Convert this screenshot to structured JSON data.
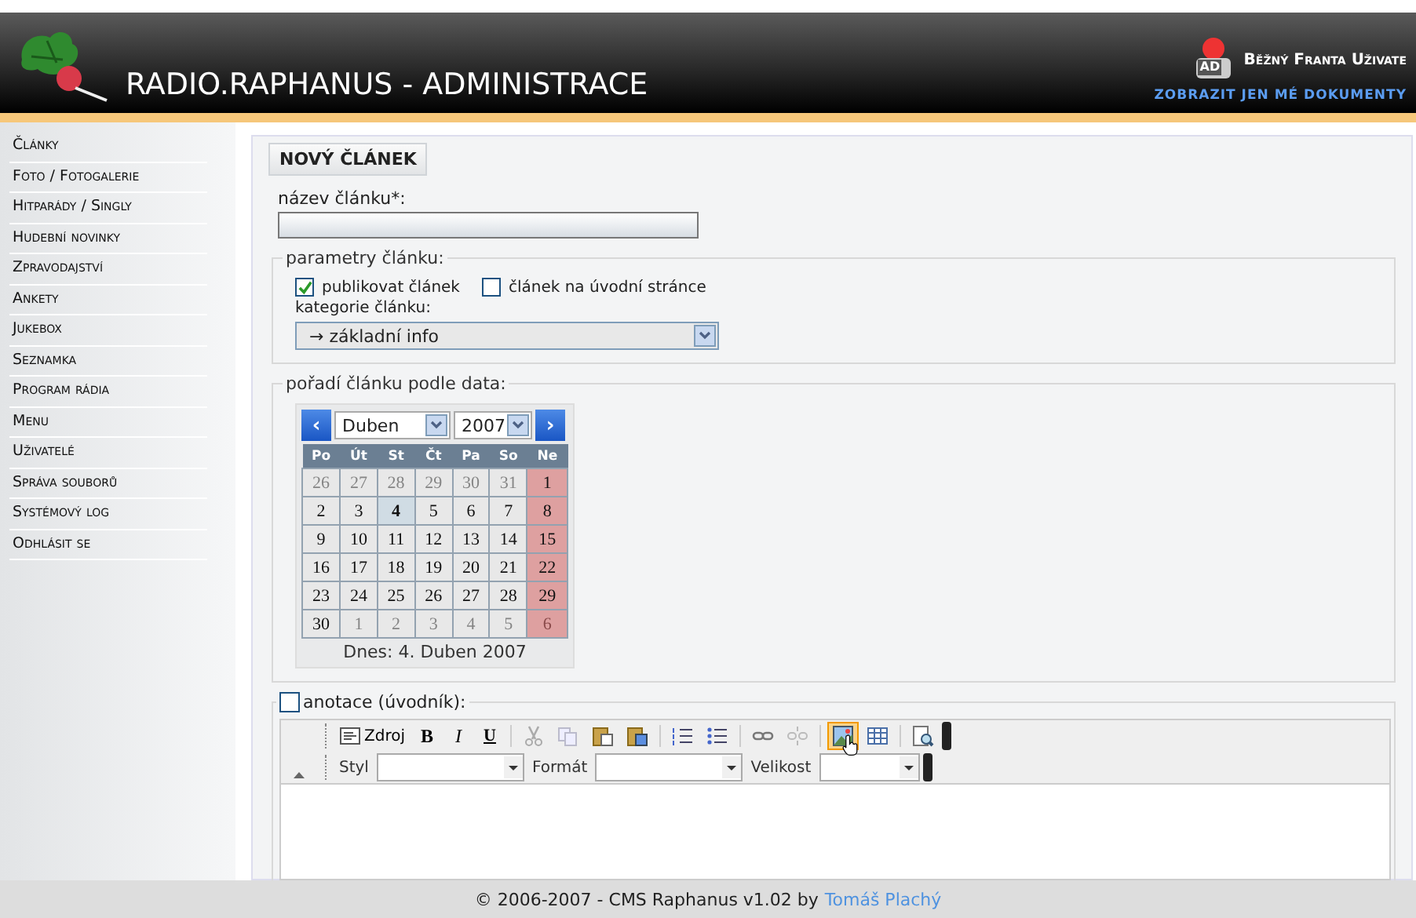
{
  "header": {
    "title": "RADIO.RAPHANUS - ADMINISTRACE",
    "user": "Běžný Franta Uživate",
    "user_badge": "AD",
    "my_docs_link": "ZOBRAZIT JEN MÉ DOKUMENTY"
  },
  "sidebar": {
    "items": [
      {
        "label": "Články"
      },
      {
        "label": "Foto / Fotogalerie"
      },
      {
        "label": "Hitparády / Singly"
      },
      {
        "label": "Hudební novinky"
      },
      {
        "label": "Zpravodajství"
      },
      {
        "label": "Ankety"
      },
      {
        "label": "Jukebox"
      },
      {
        "label": "Seznamka"
      },
      {
        "label": "Program rádia"
      },
      {
        "label": "Menu"
      },
      {
        "label": "Uživatelé"
      },
      {
        "label": "Správa souborů"
      },
      {
        "label": "Systémový log"
      },
      {
        "label": "Odhlásit se"
      }
    ]
  },
  "panel": {
    "title": "NOVÝ ČLÁNEK",
    "name_label": "název článku*:",
    "params": {
      "legend": "parametry článku:",
      "checkboxes": [
        {
          "label": "publikovat článek",
          "checked": true
        },
        {
          "label": "článek na úvodní stránce",
          "checked": false
        }
      ],
      "category_label": "kategorie článku:",
      "category_value": "→ základní info"
    },
    "date": {
      "legend": "pořadí článku podle data:",
      "calendar": {
        "prev": "‹",
        "next": "›",
        "month": "Duben",
        "year": "2007",
        "weekdays": [
          "Po",
          "Út",
          "St",
          "Čt",
          "Pa",
          "So",
          "Ne"
        ],
        "weeks": [
          [
            {
              "day": "26",
              "kind": "other"
            },
            {
              "day": "27",
              "kind": "other"
            },
            {
              "day": "28",
              "kind": "other"
            },
            {
              "day": "29",
              "kind": "other"
            },
            {
              "day": "30",
              "kind": "other"
            },
            {
              "day": "31",
              "kind": "other"
            },
            {
              "day": "1",
              "kind": "sunday"
            }
          ],
          [
            {
              "day": "2",
              "kind": "day"
            },
            {
              "day": "3",
              "kind": "day"
            },
            {
              "day": "4",
              "kind": "today"
            },
            {
              "day": "5",
              "kind": "day"
            },
            {
              "day": "6",
              "kind": "day"
            },
            {
              "day": "7",
              "kind": "day"
            },
            {
              "day": "8",
              "kind": "sunday"
            }
          ],
          [
            {
              "day": "9",
              "kind": "day"
            },
            {
              "day": "10",
              "kind": "day"
            },
            {
              "day": "11",
              "kind": "day"
            },
            {
              "day": "12",
              "kind": "day"
            },
            {
              "day": "13",
              "kind": "day"
            },
            {
              "day": "14",
              "kind": "day"
            },
            {
              "day": "15",
              "kind": "sunday"
            }
          ],
          [
            {
              "day": "16",
              "kind": "day"
            },
            {
              "day": "17",
              "kind": "day"
            },
            {
              "day": "18",
              "kind": "day"
            },
            {
              "day": "19",
              "kind": "day"
            },
            {
              "day": "20",
              "kind": "day"
            },
            {
              "day": "21",
              "kind": "day"
            },
            {
              "day": "22",
              "kind": "sunday"
            }
          ],
          [
            {
              "day": "23",
              "kind": "day"
            },
            {
              "day": "24",
              "kind": "day"
            },
            {
              "day": "25",
              "kind": "day"
            },
            {
              "day": "26",
              "kind": "day"
            },
            {
              "day": "27",
              "kind": "day"
            },
            {
              "day": "28",
              "kind": "day"
            },
            {
              "day": "29",
              "kind": "sunday"
            }
          ],
          [
            {
              "day": "30",
              "kind": "day"
            },
            {
              "day": "1",
              "kind": "other"
            },
            {
              "day": "2",
              "kind": "other"
            },
            {
              "day": "3",
              "kind": "other"
            },
            {
              "day": "4",
              "kind": "other"
            },
            {
              "day": "5",
              "kind": "other"
            },
            {
              "day": "6",
              "kind": "other-sunday"
            }
          ]
        ],
        "today_text": "Dnes: 4. Duben 2007"
      }
    },
    "annotation": {
      "label": "anotace (úvodník):",
      "checked": false,
      "toolbar": {
        "source": "Zdroj",
        "bold": "B",
        "italic": "I",
        "underline": "U",
        "image_highlighted": true,
        "combos": [
          {
            "label": "Styl"
          },
          {
            "label": "Formát"
          },
          {
            "label": "Velikost"
          }
        ]
      }
    }
  },
  "footer": {
    "text": "© 2006-2007 - CMS Raphanus v1.02 by",
    "author": "Tomáš Plachý"
  }
}
